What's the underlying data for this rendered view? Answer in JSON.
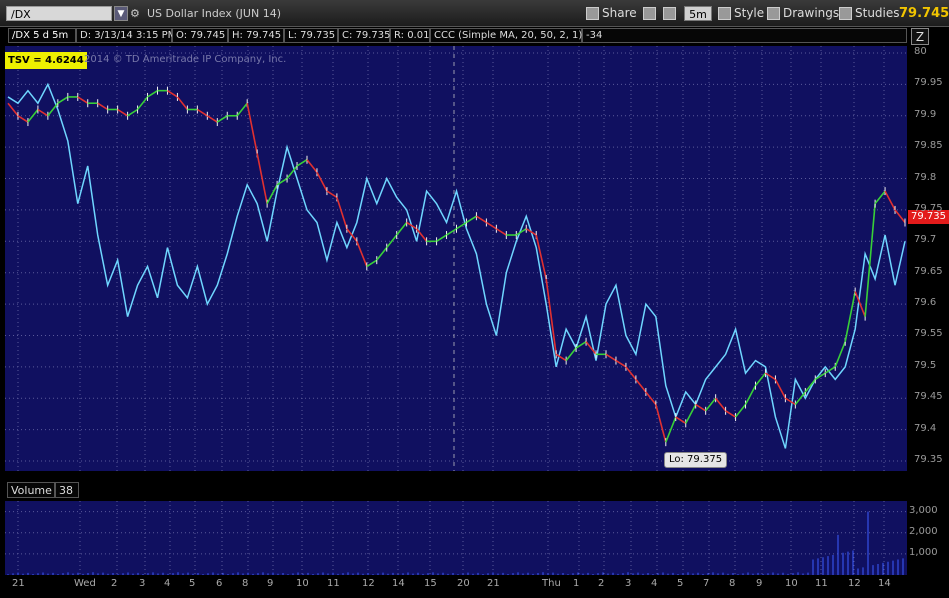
{
  "window": {
    "symbol": "/DX",
    "description": "US Dollar Index (JUN 14)",
    "share_label": "Share",
    "aggregation": "5m",
    "style_label": "Style",
    "drawings_label": "Drawings",
    "studies_label": "Studies",
    "last_price": "79.745"
  },
  "info": {
    "chart_id": "/DX 5 d 5m",
    "date": "D: 3/13/14 3:15 PM",
    "open": "O: 79.745",
    "high": "H: 79.745",
    "low": "L: 79.735",
    "close": "C: 79.735",
    "range": "R: 0.01",
    "study": "CCC (Simple MA, 20, 50, 2, 1)",
    "study_value": "-34"
  },
  "overlay": {
    "tsv": "TSV = 4.6244",
    "copyright": "2014 © TD Ameritrade IP Company, Inc."
  },
  "price_axis": {
    "labels": [
      "80",
      "79.95",
      "79.9",
      "79.85",
      "79.8",
      "79.75",
      "79.7",
      "79.65",
      "79.6",
      "79.55",
      "79.5",
      "79.45",
      "79.4",
      "79.35"
    ],
    "current": "79.735",
    "low_label": "Lo: 79.375"
  },
  "volume": {
    "label": "Volume",
    "value": "38",
    "axis_labels": [
      "3,000",
      "2,000",
      "1,000"
    ]
  },
  "time_axis": {
    "labels": [
      "21",
      "Wed",
      "2",
      "3",
      "4",
      "5",
      "6",
      "8",
      "9",
      "10",
      "11",
      "12",
      "14",
      "15",
      "20",
      "21",
      "Thu",
      "1",
      "2",
      "3",
      "4",
      "5",
      "7",
      "8",
      "9",
      "10",
      "11",
      "12",
      "14"
    ]
  },
  "chart_data": {
    "type": "line",
    "title": "US Dollar Index (JUN 14)",
    "ylim": [
      79.35,
      80.0
    ],
    "price_series": {
      "name": "/DX",
      "x": [
        0,
        10,
        20,
        30,
        40,
        50,
        60,
        70,
        80,
        90,
        100,
        110,
        120,
        130,
        140,
        150,
        160,
        170,
        180,
        190,
        200,
        210,
        220,
        230,
        240,
        250,
        260,
        270,
        280,
        290,
        300,
        310,
        320,
        330,
        340,
        350,
        360,
        370,
        380,
        390,
        400,
        410,
        420,
        430,
        440,
        450,
        460,
        470,
        480,
        490,
        500,
        510,
        520,
        530,
        540,
        550,
        560,
        570,
        580,
        590,
        600,
        610,
        620,
        630,
        640,
        650,
        660,
        670,
        680,
        690,
        700,
        710,
        720,
        730,
        740,
        750,
        760,
        770,
        780,
        790,
        800,
        810,
        820,
        830,
        840,
        850,
        860,
        870,
        880,
        890,
        900
      ],
      "close": [
        79.92,
        79.9,
        79.89,
        79.91,
        79.9,
        79.92,
        79.93,
        79.93,
        79.92,
        79.92,
        79.91,
        79.91,
        79.9,
        79.91,
        79.93,
        79.94,
        79.94,
        79.93,
        79.91,
        79.91,
        79.9,
        79.89,
        79.9,
        79.9,
        79.92,
        79.84,
        79.76,
        79.79,
        79.8,
        79.82,
        79.83,
        79.81,
        79.78,
        79.77,
        79.72,
        79.7,
        79.66,
        79.67,
        79.69,
        79.71,
        79.73,
        79.72,
        79.7,
        79.7,
        79.71,
        79.72,
        79.73,
        79.74,
        79.73,
        79.72,
        79.71,
        79.71,
        79.72,
        79.71,
        79.64,
        79.52,
        79.51,
        79.53,
        79.54,
        79.52,
        79.52,
        79.51,
        79.5,
        79.48,
        79.46,
        79.44,
        79.38,
        79.42,
        79.41,
        79.44,
        79.43,
        79.45,
        79.43,
        79.42,
        79.44,
        79.47,
        79.49,
        79.48,
        79.45,
        79.44,
        79.46,
        79.48,
        79.49,
        79.5,
        79.54,
        79.62,
        79.58,
        79.76,
        79.78,
        79.75,
        79.73
      ]
    },
    "ccc_series": {
      "x": [
        0,
        10,
        20,
        30,
        40,
        50,
        60,
        70,
        80,
        90,
        100,
        110,
        120,
        130,
        140,
        150,
        160,
        170,
        180,
        190,
        200,
        210,
        220,
        230,
        240,
        250,
        260,
        270,
        280,
        290,
        300,
        310,
        320,
        330,
        340,
        350,
        360,
        370,
        380,
        390,
        400,
        410,
        420,
        430,
        440,
        450,
        460,
        470,
        480,
        490,
        500,
        510,
        520,
        530,
        540,
        550,
        560,
        570,
        580,
        590,
        600,
        610,
        620,
        630,
        640,
        650,
        660,
        670,
        680,
        690,
        700,
        710,
        720,
        730,
        740,
        750,
        760,
        770,
        780,
        790,
        800,
        810,
        820,
        830,
        840,
        850,
        860,
        870,
        880,
        890,
        900
      ],
      "values": [
        79.93,
        79.92,
        79.94,
        79.92,
        79.95,
        79.91,
        79.86,
        79.76,
        79.82,
        79.71,
        79.63,
        79.67,
        79.58,
        79.63,
        79.66,
        79.61,
        79.69,
        79.63,
        79.61,
        79.66,
        79.6,
        79.63,
        79.68,
        79.74,
        79.79,
        79.76,
        79.7,
        79.78,
        79.85,
        79.8,
        79.75,
        79.73,
        79.67,
        79.73,
        79.69,
        79.73,
        79.8,
        79.76,
        79.8,
        79.77,
        79.75,
        79.7,
        79.78,
        79.76,
        79.73,
        79.78,
        79.72,
        79.68,
        79.6,
        79.55,
        79.65,
        79.7,
        79.74,
        79.69,
        79.6,
        79.5,
        79.56,
        79.53,
        79.58,
        79.51,
        79.6,
        79.63,
        79.55,
        79.52,
        79.6,
        79.58,
        79.47,
        79.42,
        79.46,
        79.44,
        79.48,
        79.5,
        79.52,
        79.56,
        79.49,
        79.51,
        79.5,
        79.42,
        79.37,
        79.48,
        79.45,
        79.48,
        79.5,
        79.48,
        79.5,
        79.56,
        79.68,
        79.64,
        79.71,
        79.63,
        79.7
      ]
    },
    "volume_series": {
      "name": "Volume",
      "ylim": [
        0,
        3500
      ]
    }
  }
}
